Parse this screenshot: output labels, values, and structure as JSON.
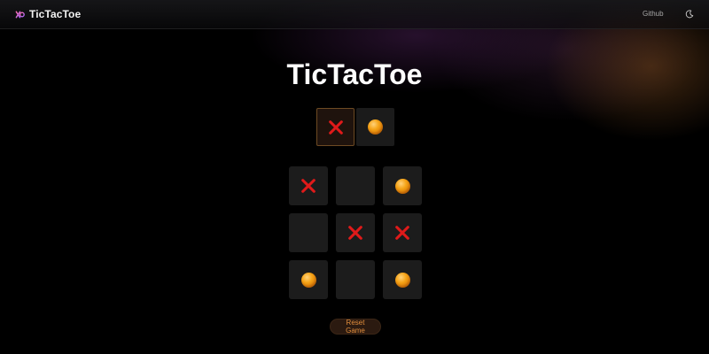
{
  "header": {
    "brand": "TicTacToe",
    "brand_icon": "xo-logo-icon",
    "nav_link": "Github",
    "theme_icon": "moon-icon"
  },
  "title": "TicTacToe",
  "player_selector": {
    "options": [
      "X",
      "O"
    ],
    "selected": "X"
  },
  "board": {
    "rows": [
      [
        "X",
        "",
        "O"
      ],
      [
        "",
        "X",
        "X"
      ],
      [
        "O",
        "",
        "O"
      ]
    ]
  },
  "reset_label": "Reset Game",
  "colors": {
    "x_mark": "#e01a1a",
    "o_mark": "#f5a316",
    "accent": "#e08d3c",
    "tile": "#1c1c1c"
  }
}
